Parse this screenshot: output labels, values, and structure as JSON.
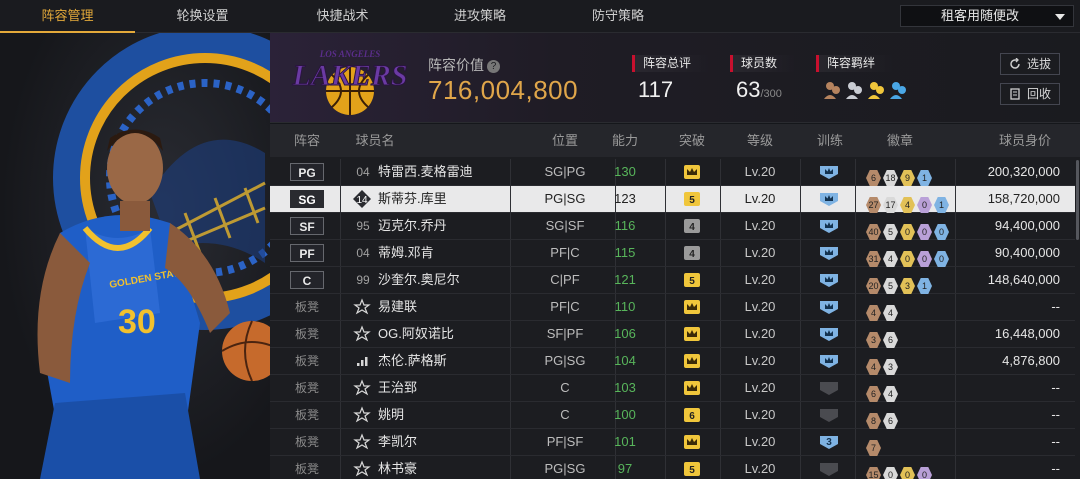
{
  "nav": {
    "tabs": [
      "阵容管理",
      "轮换设置",
      "快捷战术",
      "进攻策略",
      "防守策略"
    ],
    "active_index": 0,
    "dropdown_value": "租客用随便改"
  },
  "header": {
    "team_logo": "LAKERS",
    "team_logo_arc": "LOS ANGELES",
    "lineup_value_label": "阵容价值",
    "lineup_value": "716,004,800",
    "total_rating_label": "阵容总评",
    "total_rating": "117",
    "players_label": "球员数",
    "players_count": "63",
    "players_max": "/300",
    "bonds_label": "阵容羁绊",
    "select_button": "选拔",
    "recycle_button": "回收"
  },
  "table": {
    "columns": [
      "阵容",
      "球员名",
      "位置",
      "能力",
      "突破",
      "等级",
      "训练",
      "徽章",
      "球员身价"
    ],
    "rows": [
      {
        "slot": "PG",
        "bench": false,
        "number": "04",
        "name": "特雷西.麦格雷迪",
        "pos": "SG|PG",
        "power": "130",
        "brk": "",
        "level": "Lv.20",
        "train": "",
        "badges": [
          {
            "t": "6",
            "c": "#b58a6a"
          },
          {
            "t": "18",
            "c": "#d9d9d9"
          },
          {
            "t": "9",
            "c": "#e2c157"
          },
          {
            "t": "1",
            "c": "#7fb3e3"
          }
        ],
        "value": "200,320,000",
        "selected": false
      },
      {
        "slot": "SG",
        "bench": false,
        "number": "14",
        "name": "斯蒂芬.库里",
        "pos": "PG|SG",
        "power": "123",
        "brk": "5",
        "level": "Lv.20",
        "train": "",
        "badges": [
          {
            "t": "27",
            "c": "#b58a6a"
          },
          {
            "t": "17",
            "c": "#d9d9d9"
          },
          {
            "t": "4",
            "c": "#e2c157"
          },
          {
            "t": "0",
            "c": "#b9a0d8"
          },
          {
            "t": "1",
            "c": "#7fb3e3"
          }
        ],
        "value": "158,720,000",
        "selected": true
      },
      {
        "slot": "SF",
        "bench": false,
        "number": "95",
        "name": "迈克尔.乔丹",
        "pos": "SG|SF",
        "power": "116",
        "brk": "4",
        "level": "Lv.20",
        "train": "",
        "badges": [
          {
            "t": "40",
            "c": "#b58a6a"
          },
          {
            "t": "5",
            "c": "#d9d9d9"
          },
          {
            "t": "0",
            "c": "#e2c157"
          },
          {
            "t": "0",
            "c": "#b9a0d8"
          },
          {
            "t": "0",
            "c": "#7fb3e3"
          }
        ],
        "value": "94,400,000",
        "selected": false
      },
      {
        "slot": "PF",
        "bench": false,
        "number": "04",
        "name": "蒂姆.邓肯",
        "pos": "PF|C",
        "power": "115",
        "brk": "4",
        "level": "Lv.20",
        "train": "",
        "badges": [
          {
            "t": "31",
            "c": "#b58a6a"
          },
          {
            "t": "4",
            "c": "#d9d9d9"
          },
          {
            "t": "0",
            "c": "#e2c157"
          },
          {
            "t": "0",
            "c": "#b9a0d8"
          },
          {
            "t": "0",
            "c": "#7fb3e3"
          }
        ],
        "value": "90,400,000",
        "selected": false
      },
      {
        "slot": "C",
        "bench": false,
        "number": "99",
        "name": "沙奎尔.奥尼尔",
        "pos": "C|PF",
        "power": "121",
        "brk": "5",
        "level": "Lv.20",
        "train": "",
        "badges": [
          {
            "t": "20",
            "c": "#b58a6a"
          },
          {
            "t": "5",
            "c": "#d9d9d9"
          },
          {
            "t": "3",
            "c": "#e2c157"
          },
          {
            "t": "1",
            "c": "#7fb3e3"
          }
        ],
        "value": "148,640,000",
        "selected": false
      },
      {
        "slot": "板凳",
        "bench": true,
        "number": "",
        "name": "易建联",
        "pos": "PF|C",
        "power": "110",
        "brk": "",
        "level": "Lv.20",
        "train": "",
        "badges": [
          {
            "t": "4",
            "c": "#b58a6a"
          },
          {
            "t": "4",
            "c": "#d9d9d9"
          }
        ],
        "value": "--",
        "selected": false
      },
      {
        "slot": "板凳",
        "bench": true,
        "number": "",
        "name": "OG.阿奴诺比",
        "pos": "SF|PF",
        "power": "106",
        "brk": "",
        "level": "Lv.20",
        "train": "",
        "badges": [
          {
            "t": "3",
            "c": "#b58a6a"
          },
          {
            "t": "6",
            "c": "#d9d9d9"
          }
        ],
        "value": "16,448,000",
        "selected": false
      },
      {
        "slot": "板凳",
        "bench": true,
        "number": "",
        "name": "杰伦.萨格斯",
        "pos": "PG|SG",
        "power": "104",
        "brk": "",
        "level": "Lv.20",
        "train": "",
        "badges": [
          {
            "t": "4",
            "c": "#b58a6a"
          },
          {
            "t": "3",
            "c": "#d9d9d9"
          }
        ],
        "value": "4,876,800",
        "selected": false
      },
      {
        "slot": "板凳",
        "bench": true,
        "number": "",
        "name": "王治郅",
        "pos": "C",
        "power": "103",
        "brk": "",
        "level": "Lv.20",
        "train": "",
        "badges": [
          {
            "t": "6",
            "c": "#b58a6a"
          },
          {
            "t": "4",
            "c": "#d9d9d9"
          }
        ],
        "value": "--",
        "selected": false
      },
      {
        "slot": "板凳",
        "bench": true,
        "number": "",
        "name": "姚明",
        "pos": "C",
        "power": "100",
        "brk": "6",
        "level": "Lv.20",
        "train": "",
        "badges": [
          {
            "t": "8",
            "c": "#b58a6a"
          },
          {
            "t": "6",
            "c": "#d9d9d9"
          }
        ],
        "value": "--",
        "selected": false
      },
      {
        "slot": "板凳",
        "bench": true,
        "number": "",
        "name": "李凯尔",
        "pos": "PF|SF",
        "power": "101",
        "brk": "",
        "level": "Lv.20",
        "train": "3",
        "badges": [
          {
            "t": "7",
            "c": "#b58a6a"
          }
        ],
        "value": "--",
        "selected": false
      },
      {
        "slot": "板凳",
        "bench": true,
        "number": "",
        "name": "林书豪",
        "pos": "PG|SG",
        "power": "97",
        "brk": "5",
        "level": "Lv.20",
        "train": "",
        "badges": [
          {
            "t": "15",
            "c": "#b58a6a"
          },
          {
            "t": "0",
            "c": "#d9d9d9"
          },
          {
            "t": "0",
            "c": "#e2c157"
          },
          {
            "t": "0",
            "c": "#b9a0d8"
          }
        ],
        "value": "--",
        "selected": false
      }
    ]
  },
  "colors": {
    "accent": "#e3a93a",
    "value_gold": "#e0a64a",
    "power_green": "#58b55b"
  }
}
